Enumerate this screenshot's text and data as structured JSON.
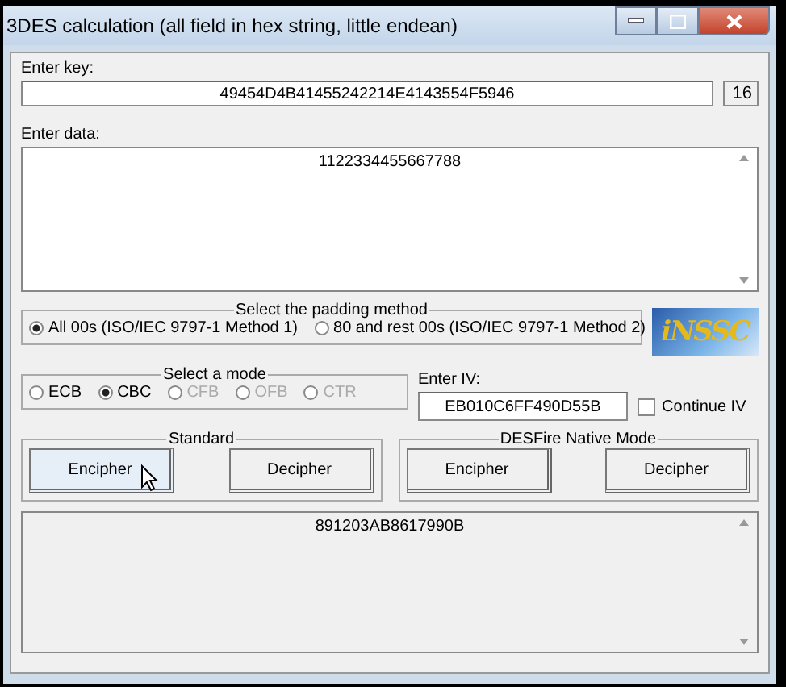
{
  "window": {
    "title": "3DES calculation (all field in hex string, little endean)"
  },
  "key": {
    "label": "Enter key:",
    "value": "49454D4B41455242214E4143554F5946",
    "length": "16"
  },
  "data": {
    "label": "Enter data:",
    "value": "1122334455667788"
  },
  "padding": {
    "title": "Select the padding method",
    "options": [
      {
        "label": "All 00s (ISO/IEC 9797-1 Method 1)",
        "selected": true
      },
      {
        "label": "80 and rest 00s (ISO/IEC 9797-1 Method 2)",
        "selected": false
      }
    ]
  },
  "logo": {
    "text": "iNSSC"
  },
  "mode": {
    "title": "Select a mode",
    "options": [
      {
        "label": "ECB",
        "selected": false,
        "disabled": false
      },
      {
        "label": "CBC",
        "selected": true,
        "disabled": false
      },
      {
        "label": "CFB",
        "selected": false,
        "disabled": true
      },
      {
        "label": "OFB",
        "selected": false,
        "disabled": true
      },
      {
        "label": "CTR",
        "selected": false,
        "disabled": true
      }
    ]
  },
  "iv": {
    "label": "Enter IV:",
    "value": "EB010C6FF490D55B",
    "continue_label": "Continue IV",
    "continue_checked": false
  },
  "groups": [
    {
      "title": "Standard",
      "buttons": [
        {
          "label": "Encipher",
          "hovered": true
        },
        {
          "label": "Decipher",
          "hovered": false
        }
      ]
    },
    {
      "title": "DESFire Native Mode",
      "buttons": [
        {
          "label": "Encipher",
          "hovered": false
        },
        {
          "label": "Decipher",
          "hovered": false
        }
      ]
    }
  ],
  "output": {
    "value": "891203AB8617990B"
  }
}
